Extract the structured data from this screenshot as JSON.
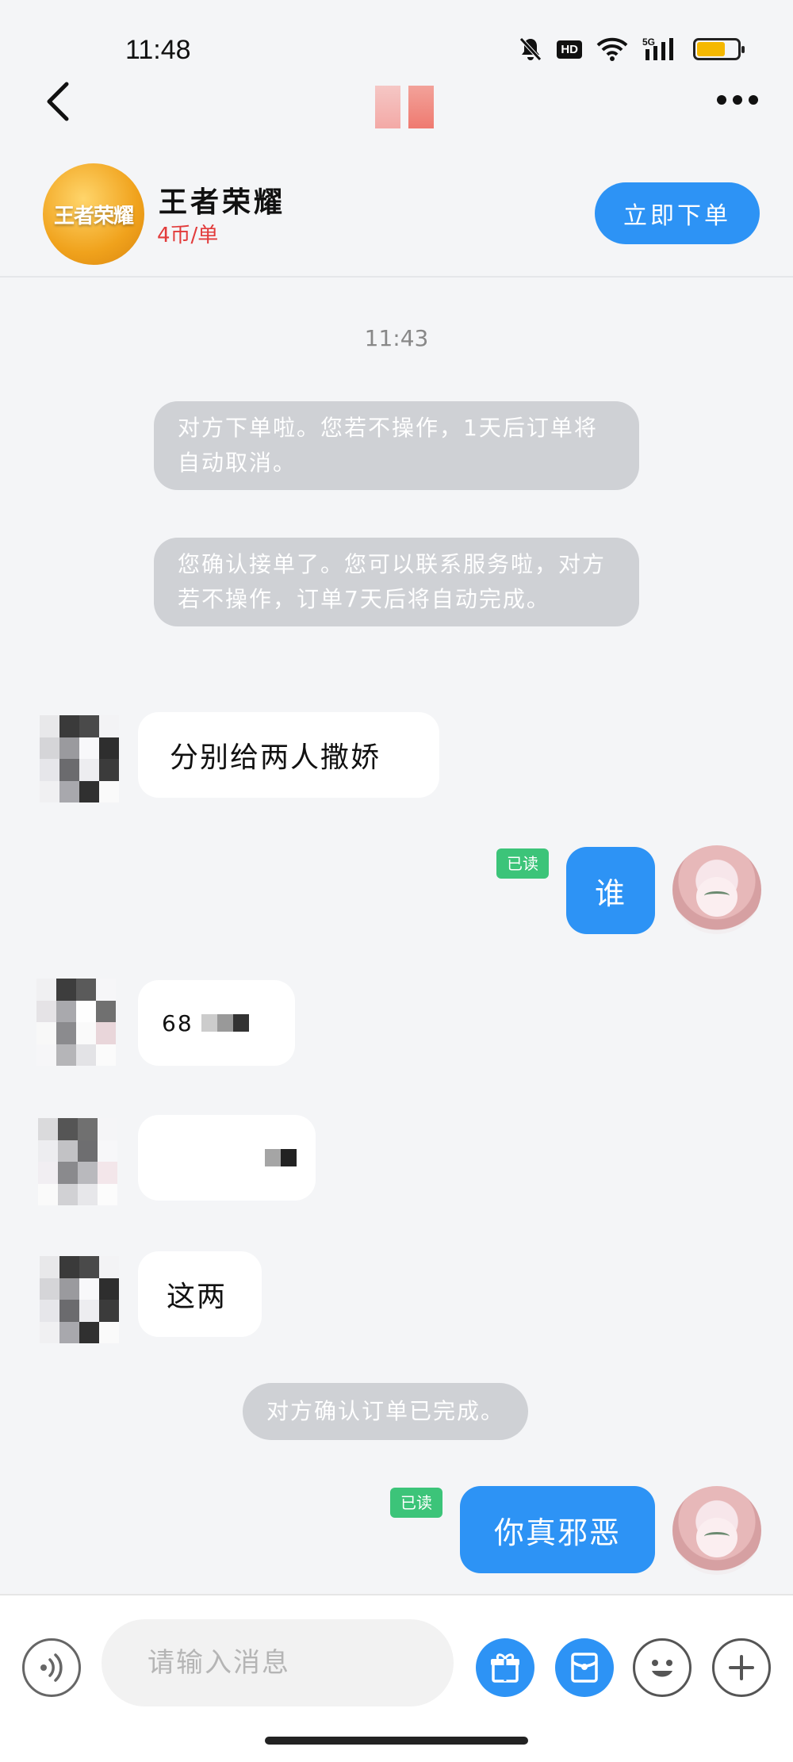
{
  "status_bar": {
    "time": "11:48",
    "hd": "HD",
    "network": "5G"
  },
  "header": {
    "game_name": "王者荣耀",
    "price": "4币/单",
    "logo_text": "王者荣耀",
    "order_button": "立即下单"
  },
  "messages": {
    "time": "11:43",
    "system_1": "对方下单啦。您若不操作，1天后订单将自动取消。",
    "system_2": "您确认接单了。您可以联系服务啦，对方若不操作，订单7天后将自动完成。",
    "in_1": "分别给两人撒娇",
    "out_1": "谁",
    "out_1_status": "已读",
    "in_2": "68",
    "in_3": "",
    "in_4": "这两",
    "system_3": "对方确认订单已完成。",
    "out_2": "你真邪恶",
    "out_2_status": "已读"
  },
  "input": {
    "placeholder": "请输入消息"
  },
  "colors": {
    "accent": "#2d93f5",
    "price": "#e23b3b",
    "read_badge": "#3cc479"
  }
}
